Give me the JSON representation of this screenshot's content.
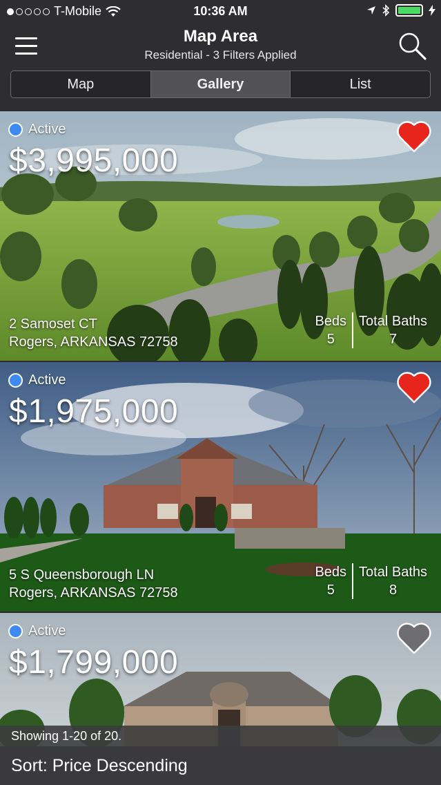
{
  "status_bar": {
    "carrier": "T-Mobile",
    "time": "10:36 AM"
  },
  "header": {
    "title": "Map Area",
    "subtitle": "Residential - 3 Filters Applied"
  },
  "tabs": [
    {
      "label": "Map",
      "selected": false
    },
    {
      "label": "Gallery",
      "selected": true
    },
    {
      "label": "List",
      "selected": false
    }
  ],
  "listings": [
    {
      "status": "Active",
      "price": "$3,995,000",
      "favorited": true,
      "address_line1": "2 Samoset CT",
      "address_line2": "Rogers, ARKANSAS 72758",
      "beds_label": "Beds",
      "beds": "5",
      "baths_label": "Total Baths",
      "baths": "7"
    },
    {
      "status": "Active",
      "price": "$1,975,000",
      "favorited": true,
      "address_line1": "5 S Queensborough LN",
      "address_line2": "Rogers, ARKANSAS 72758",
      "beds_label": "Beds",
      "beds": "5",
      "baths_label": "Total Baths",
      "baths": "8"
    },
    {
      "status": "Active",
      "price": "$1,799,000",
      "favorited": false
    }
  ],
  "footer": {
    "showing": "Showing 1-20 of 20.",
    "sort": "Sort: Price Descending"
  },
  "colors": {
    "active_dot": "#3d8bf2",
    "heart_fav": "#e8251d",
    "heart_unfav": "#6e6e72"
  }
}
